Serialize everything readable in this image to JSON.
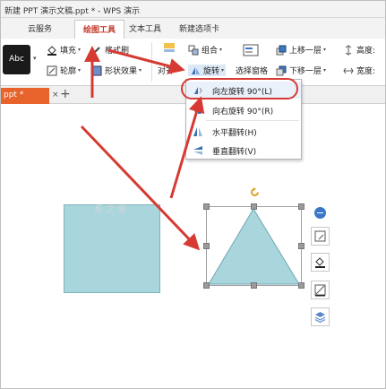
{
  "window": {
    "title": "新建 PPT 演示文稿.ppt * - WPS 演示"
  },
  "tabs": [
    {
      "label": "云服务",
      "active": false
    },
    {
      "label": "绘图工具",
      "active": true
    },
    {
      "label": "文本工具",
      "active": false
    },
    {
      "label": "新建选项卡",
      "active": false
    }
  ],
  "ribbon": {
    "style_preview": "Abc",
    "fill_label": "填充",
    "format_painter_label": "格式刷",
    "outline_label": "轮廓",
    "shape_effect_label": "形状效果",
    "align_label": "对齐",
    "group_label": "组合",
    "rotate_label": "旋转",
    "selection_pane_label": "选择窗格",
    "bring_forward_label": "上移一层",
    "send_backward_label": "下移一层",
    "height_label": "高度:",
    "width_label": "宽度:"
  },
  "document_tab": {
    "label": "ppt *",
    "close": "×",
    "new": "+"
  },
  "rotate_menu": {
    "items": [
      {
        "label": "向左旋转 90°(L)",
        "icon": "rotate-left-icon"
      },
      {
        "label": "向右旋转 90°(R)",
        "icon": "rotate-right-icon"
      },
      {
        "label": "水平翻转(H)",
        "icon": "flip-horizontal-icon"
      },
      {
        "label": "垂直翻转(V)",
        "icon": "flip-vertical-icon"
      }
    ]
  },
  "canvas": {
    "watermark": "系 之 家"
  },
  "colors": {
    "accent_red": "#d63a32",
    "shape_fill": "#a9d5dc",
    "doc_tab": "#e8622c"
  }
}
